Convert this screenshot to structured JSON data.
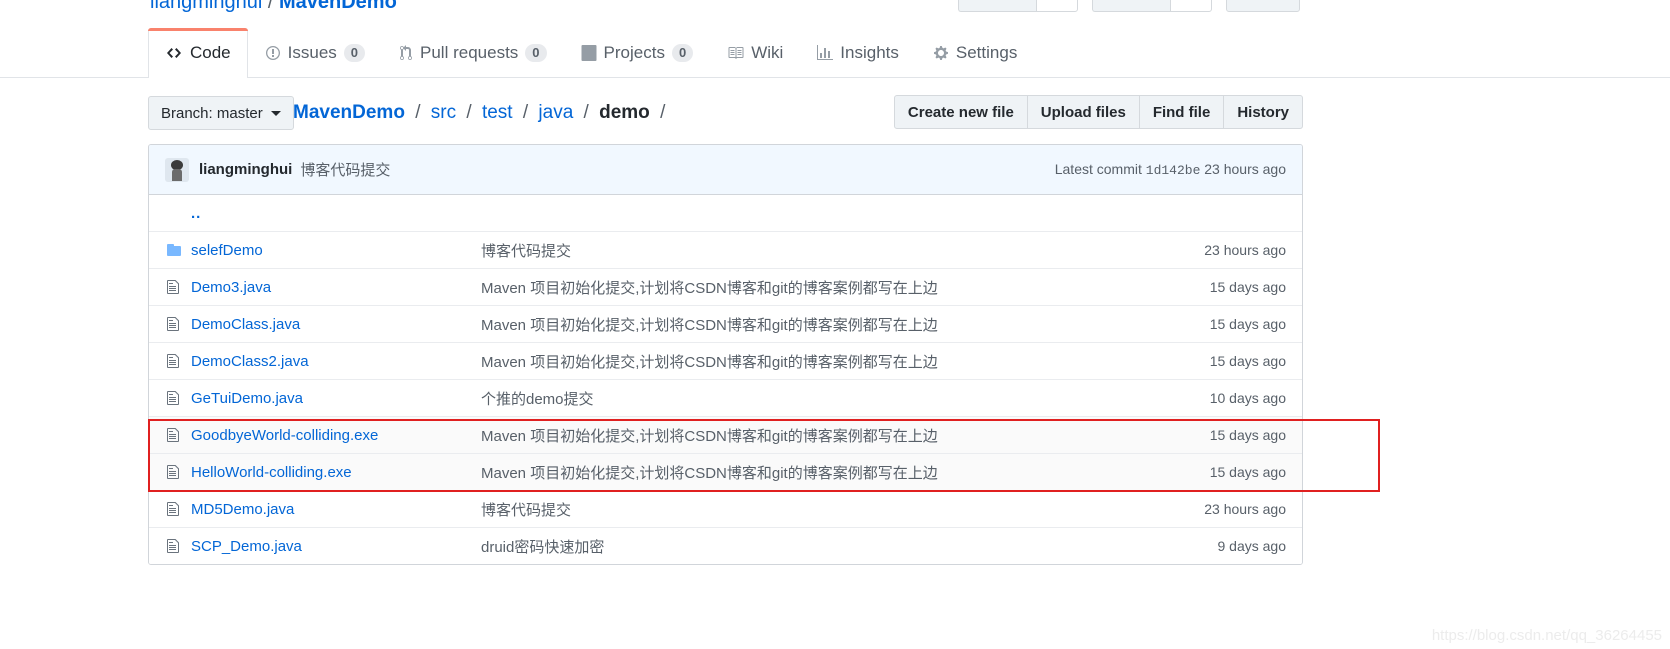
{
  "repo": {
    "owner": "liangminghui",
    "separator": "/",
    "name": "MavenDemo"
  },
  "nav": {
    "tabs": [
      {
        "label": "Code",
        "icon": "code-icon",
        "count": null,
        "selected": true
      },
      {
        "label": "Issues",
        "icon": "issue-opened-icon",
        "count": "0",
        "selected": false
      },
      {
        "label": "Pull requests",
        "icon": "git-pull-request-icon",
        "count": "0",
        "selected": false
      },
      {
        "label": "Projects",
        "icon": "project-icon",
        "count": "0",
        "selected": false
      },
      {
        "label": "Wiki",
        "icon": "book-icon",
        "count": null,
        "selected": false
      },
      {
        "label": "Insights",
        "icon": "graph-icon",
        "count": null,
        "selected": false
      },
      {
        "label": "Settings",
        "icon": "gear-icon",
        "count": null,
        "selected": false
      }
    ]
  },
  "filebar": {
    "branch_label": "Branch: master",
    "breadcrumb": {
      "root": "MavenDemo",
      "path": [
        "src",
        "test",
        "java"
      ],
      "current": "demo",
      "trailing_slash": "/"
    },
    "buttons": [
      "Create new file",
      "Upload files",
      "Find file",
      "History"
    ]
  },
  "commit": {
    "author": "liangminghui",
    "message": "博客代码提交",
    "latest_label": "Latest commit",
    "sha": "1d142be",
    "age": "23 hours ago"
  },
  "table": {
    "parent_dir": "..",
    "rows": [
      {
        "type": "dir",
        "icon": "folder-icon",
        "name": "selefDemo",
        "message": "博客代码提交",
        "age": "23 hours ago"
      },
      {
        "type": "file",
        "icon": "file-icon",
        "name": "Demo3.java",
        "message": "Maven 项目初始化提交,计划将CSDN博客和git的博客案例都写在上边",
        "age": "15 days ago"
      },
      {
        "type": "file",
        "icon": "file-icon",
        "name": "DemoClass.java",
        "message": "Maven 项目初始化提交,计划将CSDN博客和git的博客案例都写在上边",
        "age": "15 days ago"
      },
      {
        "type": "file",
        "icon": "file-icon",
        "name": "DemoClass2.java",
        "message": "Maven 项目初始化提交,计划将CSDN博客和git的博客案例都写在上边",
        "age": "15 days ago"
      },
      {
        "type": "file",
        "icon": "file-icon",
        "name": "GeTuiDemo.java",
        "message": "个推的demo提交",
        "age": "10 days ago"
      },
      {
        "type": "file",
        "icon": "file-icon",
        "name": "GoodbyeWorld-colliding.exe",
        "message": "Maven 项目初始化提交,计划将CSDN博客和git的博客案例都写在上边",
        "age": "15 days ago",
        "highlighted": true
      },
      {
        "type": "file",
        "icon": "file-icon",
        "name": "HelloWorld-colliding.exe",
        "message": "Maven 项目初始化提交,计划将CSDN博客和git的博客案例都写在上边",
        "age": "15 days ago",
        "highlighted": true
      },
      {
        "type": "file",
        "icon": "file-icon",
        "name": "MD5Demo.java",
        "message": "博客代码提交",
        "age": "23 hours ago"
      },
      {
        "type": "file",
        "icon": "file-icon",
        "name": "SCP_Demo.java",
        "message": "druid密码快速加密",
        "age": "9 days ago"
      }
    ]
  },
  "annotation": {
    "color": "#e02020"
  },
  "watermark": {
    "text": "https://blog.csdn.net/qq_36264455"
  }
}
